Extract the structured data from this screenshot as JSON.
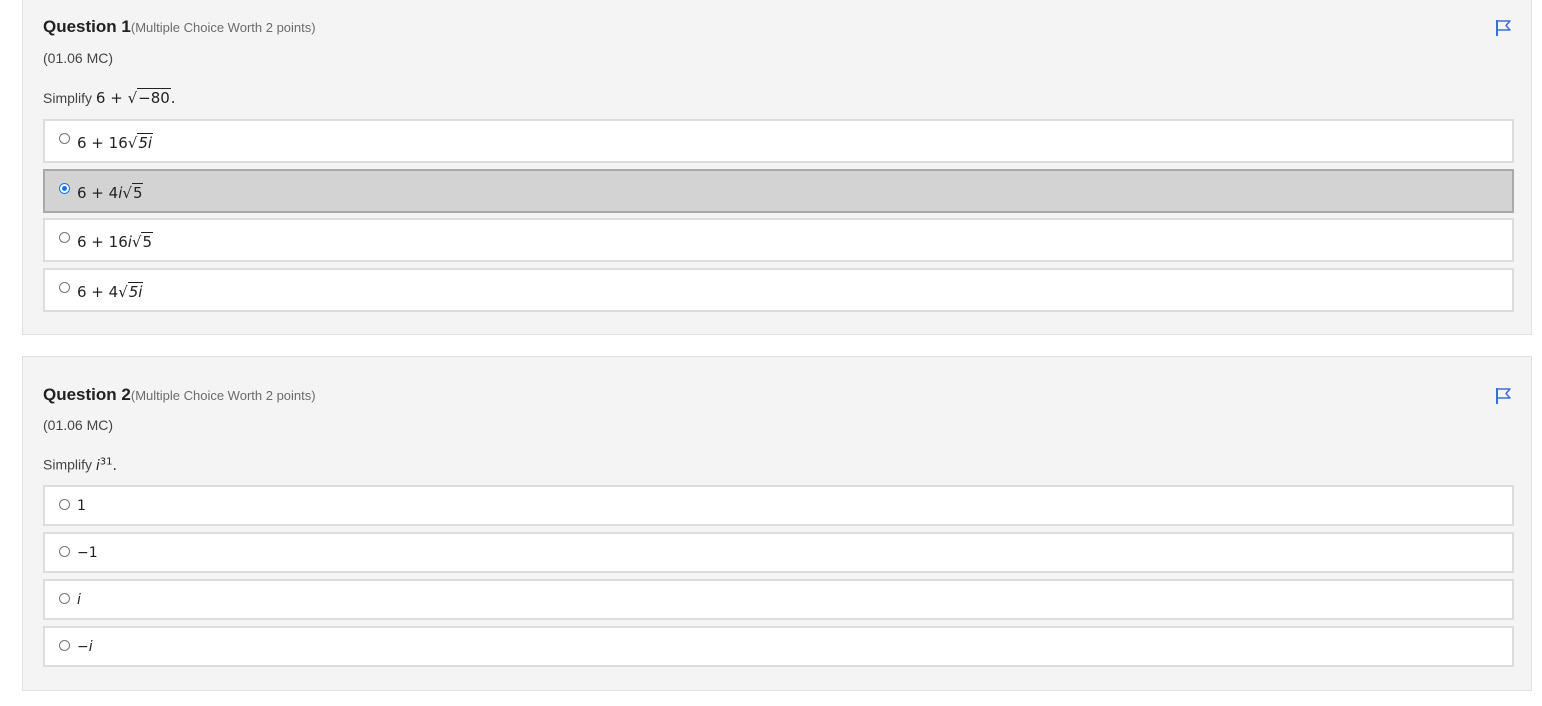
{
  "questions": [
    {
      "title": "Question 1",
      "subtitle": "(Multiple Choice Worth 2 points)",
      "code": "(01.06 MC)",
      "prompt_text": "Simplify",
      "prompt_math": {
        "lead": "6 +",
        "radicand": "−80",
        "trail": "."
      },
      "selected_index": 1,
      "options": [
        {
          "a": "6 + 16",
          "radicand": "5i",
          "b": ""
        },
        {
          "a": "6 + 4",
          "i": "i",
          "radicand": "5"
        },
        {
          "a": "6 + 16",
          "i": "i",
          "radicand": "5"
        },
        {
          "a": "6 + 4",
          "radicand": "5i",
          "b": ""
        }
      ]
    },
    {
      "title": "Question 2",
      "subtitle": "(Multiple Choice Worth 2 points)",
      "code": "(01.06 MC)",
      "prompt_text": "Simplify",
      "prompt_math": {
        "base": "i",
        "exp": "31",
        "trail": "."
      },
      "selected_index": null,
      "options": [
        {
          "label": "1"
        },
        {
          "label": "−1"
        },
        {
          "label": "i"
        },
        {
          "label": "−i"
        }
      ]
    }
  ],
  "colors": {
    "accent": "#1a73e8",
    "flag": "#3b6fd8",
    "panel_bg": "#f4f4f4",
    "selected_bg": "#d3d3d3"
  },
  "icons": {
    "flag": "flag-icon"
  }
}
